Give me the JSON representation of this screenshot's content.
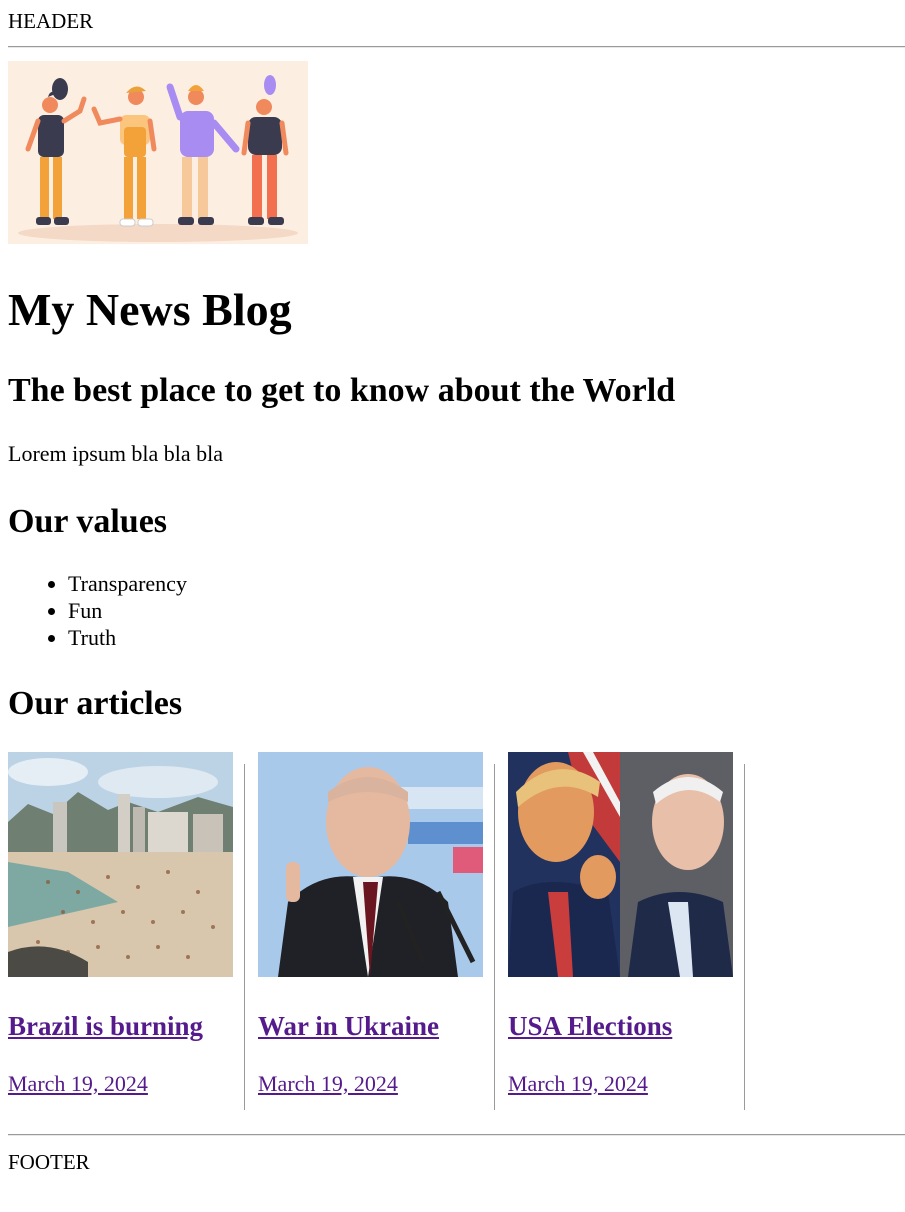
{
  "header": {
    "text": "HEADER"
  },
  "hero": {
    "alt": "Illustration of four waving people"
  },
  "main": {
    "title": "My News Blog",
    "tagline": "The best place to get to know about the World",
    "intro": "Lorem ipsum bla bla bla",
    "values_title": "Our values",
    "values": [
      "Transparency",
      "Fun",
      "Truth"
    ],
    "articles_title": "Our articles",
    "articles": [
      {
        "title": "Brazil is burning",
        "date": "March 19, 2024",
        "image": "beach-photo"
      },
      {
        "title": "War in Ukraine",
        "date": "March 19, 2024",
        "image": "speaker-photo"
      },
      {
        "title": "USA Elections",
        "date": "March 19, 2024",
        "image": "candidates-photo"
      }
    ]
  },
  "footer": {
    "text": "FOOTER"
  },
  "colors": {
    "link": "#551a8b",
    "rule": "#999999",
    "hero_bg": "#fdeee2"
  }
}
